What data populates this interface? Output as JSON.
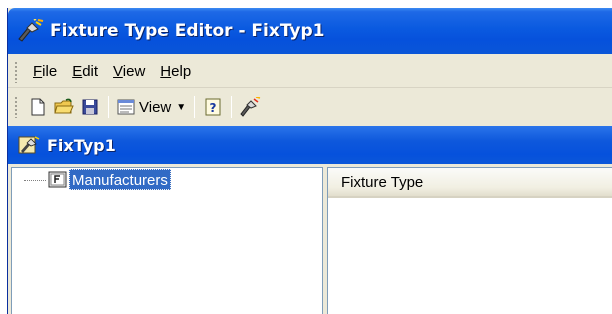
{
  "window": {
    "title": "Fixture Type Editor - FixTyp1",
    "icon": "fixture-lamp-icon"
  },
  "menu": {
    "items": [
      {
        "label": "File",
        "accel": "F",
        "rest": "ile"
      },
      {
        "label": "Edit",
        "accel": "E",
        "rest": "dit"
      },
      {
        "label": "View",
        "accel": "V",
        "rest": "iew"
      },
      {
        "label": "Help",
        "accel": "H",
        "rest": "elp"
      }
    ]
  },
  "toolbar": {
    "view_label": "View",
    "buttons": [
      "new-document-icon",
      "open-folder-icon",
      "save-disk-icon",
      "view-icon",
      "help-icon",
      "fixture-lamp-icon"
    ]
  },
  "document": {
    "title": "FixTyp1"
  },
  "tree": {
    "nodes": [
      {
        "label": "Manufacturers",
        "selected": true
      }
    ]
  },
  "list": {
    "columns": [
      "Fixture Type"
    ]
  },
  "colors": {
    "titlebar": "#0a5ae0",
    "selection": "#316ac5",
    "face": "#ece9d8"
  }
}
